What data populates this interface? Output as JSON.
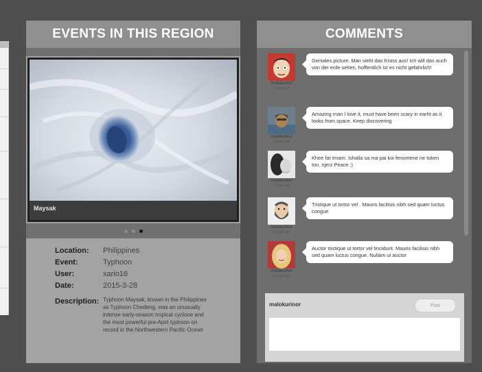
{
  "events": {
    "title": "EVENTS IN THIS REGION",
    "photo_caption": "Maysak",
    "carousel": {
      "count": 3,
      "active": 3
    },
    "details": {
      "location_label": "Location:",
      "location": "Philippines",
      "event_label": "Event:",
      "event": "Typhoon",
      "user_label": "User:",
      "user": "xario16",
      "date_label": "Date:",
      "date": "2015-3-28",
      "description_label": "Description:",
      "description": "Typhoon Maysak, known in the Philippines as Typhoon Chedeng, was an unusually intense early-season tropical cyclone and the most powerful pre-April typhoon on record in the Northwestern Pacific Ocean"
    }
  },
  "comments": {
    "title": "COMMENTS",
    "items": [
      {
        "author": "malokurinor",
        "time": "7 years ago",
        "avatar": "cartoon-face-icon",
        "text": "Geniales picture. Man sieht das Krass aus! Ich will das auch von der erde sehen, hoffentlich ist es nicht gefahrlich!"
      },
      {
        "author": "malokurinor",
        "time": "7 years ago",
        "avatar": "photo-avatar",
        "text": "Amazing man I love it, must have been scary in earht as it looks from space. Keep discovering"
      },
      {
        "author": "malokurinor",
        "time": "7 years ago",
        "avatar": "photo-avatar",
        "text": "Khee far tmarri. Ishalla sa ma pai koi fenomene ne token ton. njerz Peace :)"
      },
      {
        "author": "malokurinor",
        "time": "7 years ago",
        "avatar": "bearded-face-icon",
        "text": "Tristique ut tortor vel . Mauris facilisis nibh sed quam luctus congue"
      },
      {
        "author": "malokurinor",
        "time": "7 years ago",
        "avatar": "blonde-avatar",
        "text": "Auctor tristique ut tortor vel tincidunt. Mauris facilisis nibh sed quam luctus congue. Nullam ut auctor"
      }
    ],
    "reply": {
      "user": "malokurinor",
      "post_label": "Post",
      "placeholder": ""
    }
  }
}
